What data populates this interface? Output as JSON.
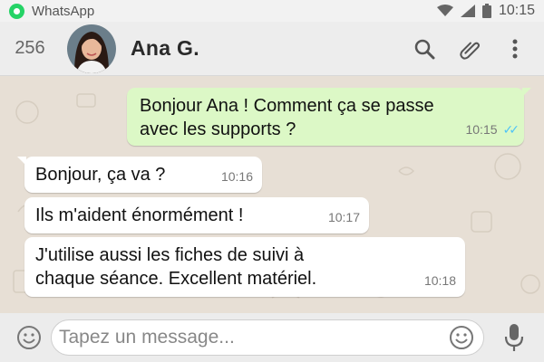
{
  "status_bar": {
    "app_name": "WhatsApp",
    "time": "10:15",
    "icons": [
      "whatsapp-icon",
      "wifi-icon",
      "signal-icon",
      "battery-icon"
    ]
  },
  "header": {
    "unread_count": "256",
    "contact_name": "Ana G.",
    "actions": [
      "search-icon",
      "attachment-icon",
      "more-options-icon"
    ]
  },
  "messages": [
    {
      "direction": "out",
      "text": "Bonjour Ana ! Comment ça se passe\navec les supports ?",
      "time": "10:15",
      "status": "read"
    },
    {
      "direction": "in",
      "text": "Bonjour, ça va ?",
      "time": "10:16"
    },
    {
      "direction": "in",
      "text": "Ils m'aident énormément !",
      "time": "10:17"
    },
    {
      "direction": "in",
      "text": "J'utilise aussi les fiches de suivi à\nchaque séance. Excellent matériel.",
      "time": "10:18"
    }
  ],
  "composer": {
    "placeholder": "Tapez un message...",
    "icons": [
      "emoji-icon",
      "emoji-icon",
      "microphone-icon"
    ]
  },
  "colors": {
    "outgoing_bubble": "#dcf8c6",
    "incoming_bubble": "#ffffff",
    "chat_background": "#e7dfd5",
    "read_ticks": "#4fc3f7"
  }
}
